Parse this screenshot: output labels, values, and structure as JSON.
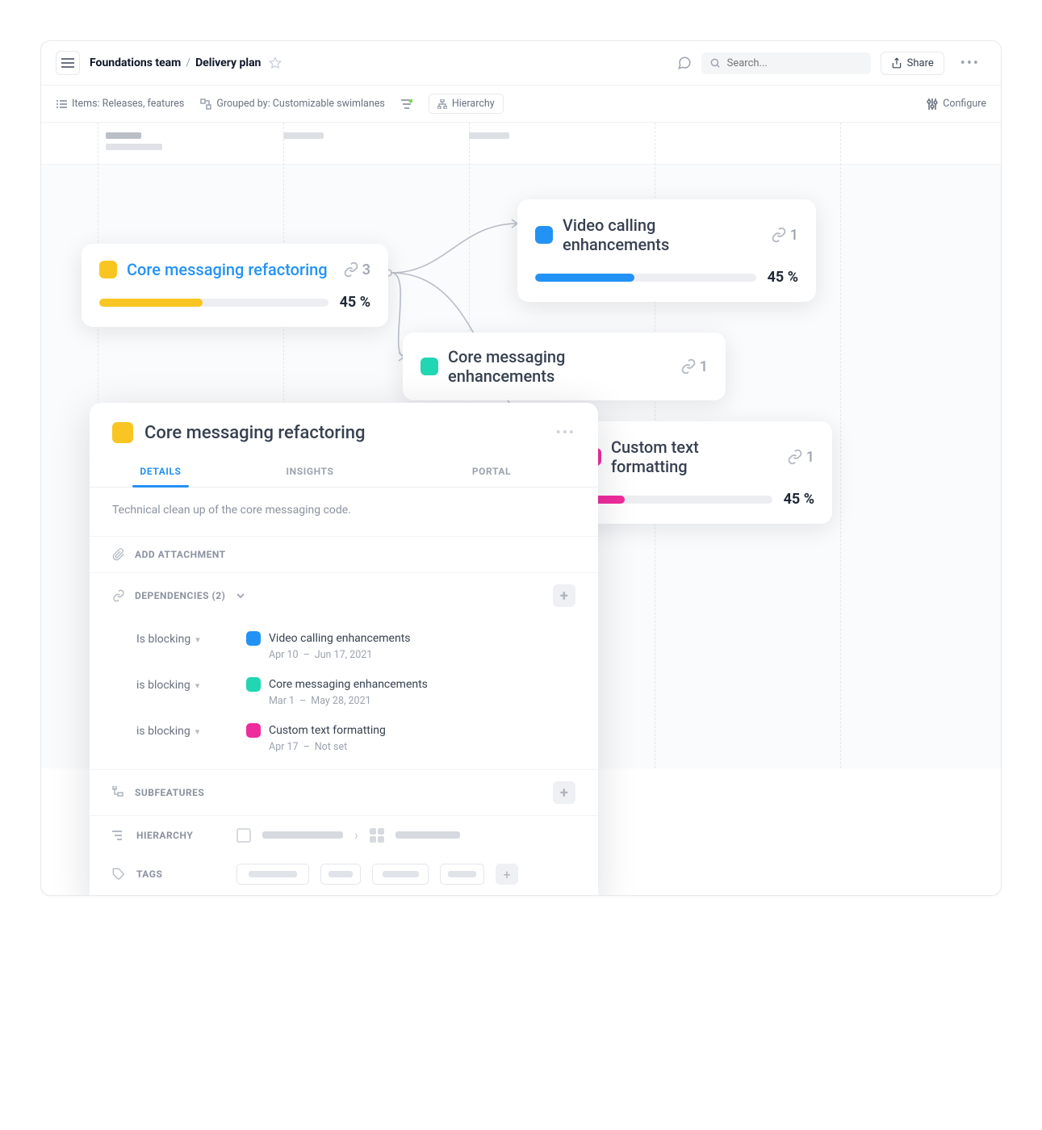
{
  "header": {
    "team": "Foundations team",
    "page": "Delivery plan",
    "search_placeholder": "Search...",
    "share_label": "Share"
  },
  "filters": {
    "items": "Items: Releases, features",
    "grouped": "Grouped by: Customizable swimlanes",
    "hierarchy_chip": "Hierarchy",
    "configure": "Configure"
  },
  "cards": {
    "core_refactoring": {
      "title": "Core messaging refactoring",
      "links": "3",
      "progress": "45 %",
      "progress_pct": 45,
      "color": "#f9c522"
    },
    "video_calling": {
      "title": "Video calling enhancements",
      "links": "1",
      "progress": "45 %",
      "progress_pct": 45,
      "color": "#2392f5"
    },
    "core_enhancements": {
      "title": "Core messaging enhancements",
      "links": "1",
      "color": "#21d6b2"
    },
    "custom_text": {
      "title": "Custom text formatting",
      "links": "1",
      "progress": "45 %",
      "progress_pct": 22,
      "color": "#ef2c9c"
    }
  },
  "detail": {
    "title": "Core messaging refactoring",
    "color": "#f9c522",
    "tabs": {
      "details": "DETAILS",
      "insights": "INSIGHTS",
      "portal": "PORTAL"
    },
    "description": "Technical clean up of the core messaging code.",
    "add_attachment": "ADD ATTACHMENT",
    "dependencies_label": "DEPENDENCIES (2)",
    "dependencies": [
      {
        "relation": "Is blocking",
        "name": "Video calling enhancements",
        "color": "#2392f5",
        "date_from": "Apr 10",
        "date_to": "Jun 17, 2021"
      },
      {
        "relation": "is blocking",
        "name": "Core messaging enhancements",
        "color": "#21d6b2",
        "date_from": "Mar 1",
        "date_to": "May 28, 2021"
      },
      {
        "relation": "is blocking",
        "name": "Custom text formatting",
        "color": "#ef2c9c",
        "date_from": "Apr 17",
        "date_to": "Not set"
      }
    ],
    "subfeatures_label": "SUBFEATURES",
    "hierarchy_label": "HIERARCHY",
    "tags_label": "TAGS"
  }
}
